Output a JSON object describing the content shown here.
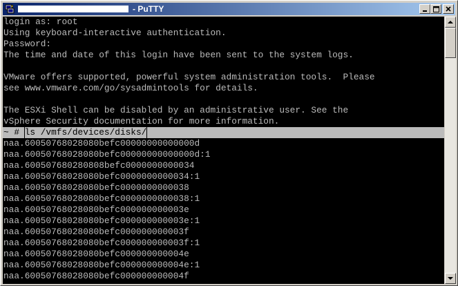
{
  "window": {
    "title": "- PuTTY"
  },
  "colors": {
    "terminal_bg": "#000000",
    "terminal_fg": "#bbbbbb",
    "titlebar_start": "#0a246a",
    "titlebar_end": "#a6caf0"
  },
  "icons": {
    "app": "putty-icon",
    "minimize": "minimize-icon",
    "maximize": "maximize-icon",
    "close": "close-icon",
    "scroll_up": "scroll-up-arrow-icon",
    "scroll_down": "scroll-down-arrow-icon"
  },
  "terminal": {
    "lines": [
      "login as: root",
      "Using keyboard-interactive authentication.",
      "Password:",
      "The time and date of this login have been sent to the system logs.",
      "",
      "VMware offers supported, powerful system administration tools.  Please",
      "see www.vmware.com/go/sysadmintools for details.",
      "",
      "The ESXi Shell can be disabled by an administrative user. See the",
      "vSphere Security documentation for more information.",
      "naa.60050768028080befc00000000000000d",
      "naa.60050768028080befc00000000000000d:1",
      "naa.600507680280808befc0000000000034",
      "naa.60050768028080befc0000000000034:1",
      "naa.60050768028080befc0000000000038",
      "naa.60050768028080befc0000000000038:1",
      "naa.60050768028080befc000000000003e",
      "naa.60050768028080befc000000000003e:1",
      "naa.60050768028080befc000000000003f",
      "naa.60050768028080befc000000000003f:1",
      "naa.60050768028080befc000000000004e",
      "naa.60050768028080befc000000000004e:1",
      "naa.60050768028080befc000000000004f"
    ],
    "prompt": "~ # ",
    "command": "ls /vmfs/devices/disks/"
  }
}
